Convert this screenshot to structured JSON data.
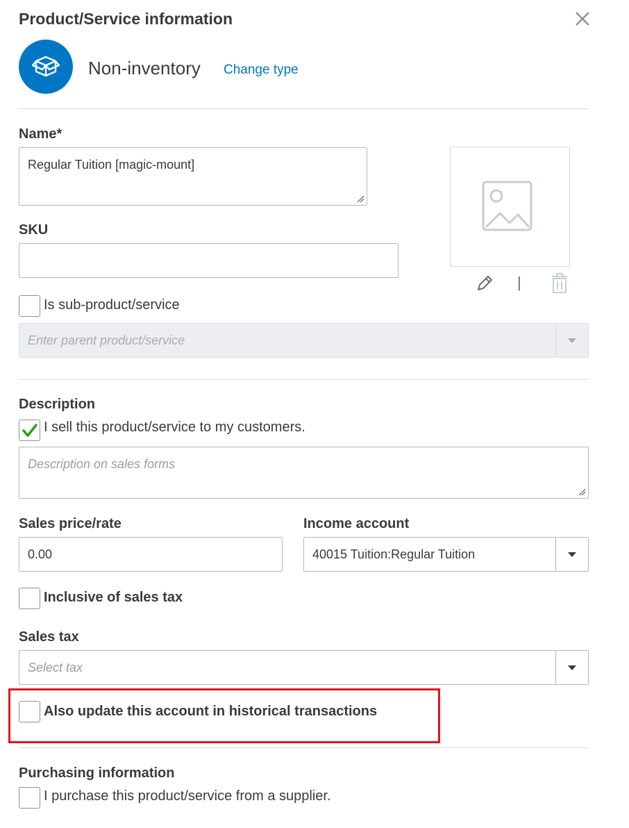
{
  "dialog": {
    "title": "Product/Service information"
  },
  "item_type": {
    "label": "Non-inventory",
    "change_link": "Change type",
    "accent_color": "#0077c5"
  },
  "name": {
    "label": "Name*",
    "value": "Regular Tuition [magic-mount]"
  },
  "sku": {
    "label": "SKU",
    "value": ""
  },
  "sub_product": {
    "checkbox_label": "Is sub-product/service",
    "checked": false,
    "parent_placeholder": "Enter parent product/service"
  },
  "image": {
    "placeholder_icon": "image-placeholder-icon",
    "edit_icon": "pencil-icon",
    "separator": "|",
    "delete_icon": "trash-icon"
  },
  "sales": {
    "section_label": "Description",
    "sell_checkbox_label": "I sell this product/service to my customers.",
    "sell_checked": true,
    "description_placeholder": "Description on sales forms",
    "price_label": "Sales price/rate",
    "price_value": "0.00",
    "income_account_label": "Income account",
    "income_account_value": "40015 Tuition:Regular Tuition",
    "inclusive_tax_label": "Inclusive of sales tax",
    "inclusive_tax_checked": false,
    "sales_tax_label": "Sales tax",
    "sales_tax_placeholder": "Select tax",
    "historical_update_label": "Also update this account in historical transactions",
    "historical_update_checked": false
  },
  "purchasing": {
    "section_label": "Purchasing information",
    "purchase_checkbox_label": "I purchase this product/service from a supplier.",
    "purchase_checked": false
  },
  "colors": {
    "check_green": "#2ca01c",
    "highlight_red": "#e0141e"
  }
}
